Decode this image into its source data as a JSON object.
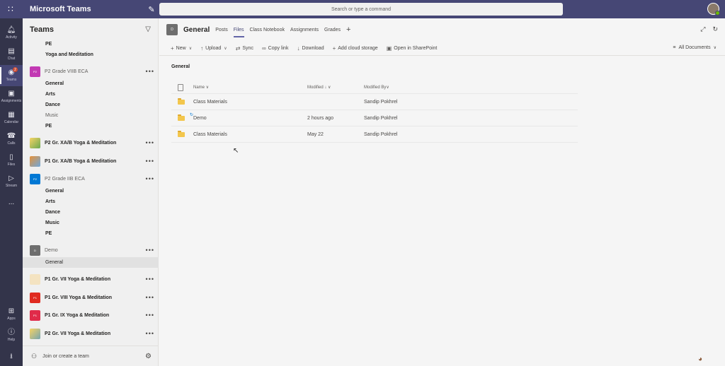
{
  "app": {
    "title": "Microsoft Teams",
    "search_placeholder": "Search or type a command"
  },
  "rail": [
    {
      "label": "Activity",
      "icon": "bell-icon"
    },
    {
      "label": "Chat",
      "icon": "chat-icon"
    },
    {
      "label": "Teams",
      "icon": "teams-icon",
      "badge": "2"
    },
    {
      "label": "Assignments",
      "icon": "assignments-icon"
    },
    {
      "label": "Calendar",
      "icon": "calendar-icon"
    },
    {
      "label": "Calls",
      "icon": "phone-icon"
    },
    {
      "label": "Files",
      "icon": "files-icon"
    },
    {
      "label": "Stream",
      "icon": "stream-icon"
    },
    {
      "label": "...",
      "icon": "more-icon"
    },
    {
      "label": "Apps",
      "icon": "apps-icon"
    },
    {
      "label": "Help",
      "icon": "help-icon"
    }
  ],
  "teams_panel": {
    "title": "Teams",
    "join_label": "Join or create a team",
    "top_channels": [
      "PE",
      "Yoga and Meditation"
    ],
    "teams": [
      {
        "name": "P2 Grade VIIB ECA",
        "tile": "P2",
        "color": "#c239b3",
        "light": true,
        "channels": [
          {
            "name": "General"
          },
          {
            "name": "Arts"
          },
          {
            "name": "Dance"
          },
          {
            "name": "Music",
            "light": true
          },
          {
            "name": "PE"
          }
        ]
      },
      {
        "name": "P2 Gr. XA/B Yoga & Meditation",
        "tile": "",
        "color": "#6aa84f"
      },
      {
        "name": "P1 Gr. XA/B Yoga & Meditation",
        "tile": "",
        "color": "#e69138"
      },
      {
        "name": "P2 Grade IIB ECA",
        "tile": "P2",
        "color": "#0078d4",
        "light": true,
        "channels": [
          {
            "name": "General"
          },
          {
            "name": "Arts"
          },
          {
            "name": "Dance"
          },
          {
            "name": "Music"
          },
          {
            "name": "PE"
          }
        ]
      },
      {
        "name": "Demo",
        "tile": "D",
        "color": "#6e6e6e",
        "light": true,
        "channels": [
          {
            "name": "General",
            "selected": true
          }
        ]
      },
      {
        "name": "P1 Gr. VII Yoga & Meditation",
        "tile": "",
        "color": "#f4e3c1"
      },
      {
        "name": "P1 Gr. VIII Yoga & Meditation",
        "tile": "P1",
        "color": "#e02b20"
      },
      {
        "name": "P1 Gr. IX Yoga & Meditation",
        "tile": "P1",
        "color": "#e02b4a"
      },
      {
        "name": "P2 Gr. VII Yoga & Meditation",
        "tile": "",
        "color": "#76a5af"
      }
    ]
  },
  "channel": {
    "avatar": "D",
    "title": "General",
    "tabs": [
      "Posts",
      "Files",
      "Class Notebook",
      "Assignments",
      "Grades"
    ],
    "active_tab": "Files"
  },
  "toolbar": {
    "new": "New",
    "upload": "Upload",
    "sync": "Sync",
    "copy_link": "Copy link",
    "download": "Download",
    "add_cloud": "Add cloud storage",
    "open_sharepoint": "Open in SharePoint",
    "view": "All Documents"
  },
  "files": {
    "breadcrumb": "General",
    "columns": {
      "name": "Name",
      "modified": "Modified",
      "modified_by": "Modified By"
    },
    "rows": [
      {
        "name": "Class Materials",
        "modified": "",
        "modified_by": "Sandip Pokhrel"
      },
      {
        "name": "Demo",
        "modified": "2 hours ago",
        "modified_by": "Sandip Pokhrel"
      },
      {
        "name": "Class Materials",
        "modified": "May 22",
        "modified_by": "Sandip Pokhrel"
      }
    ]
  }
}
